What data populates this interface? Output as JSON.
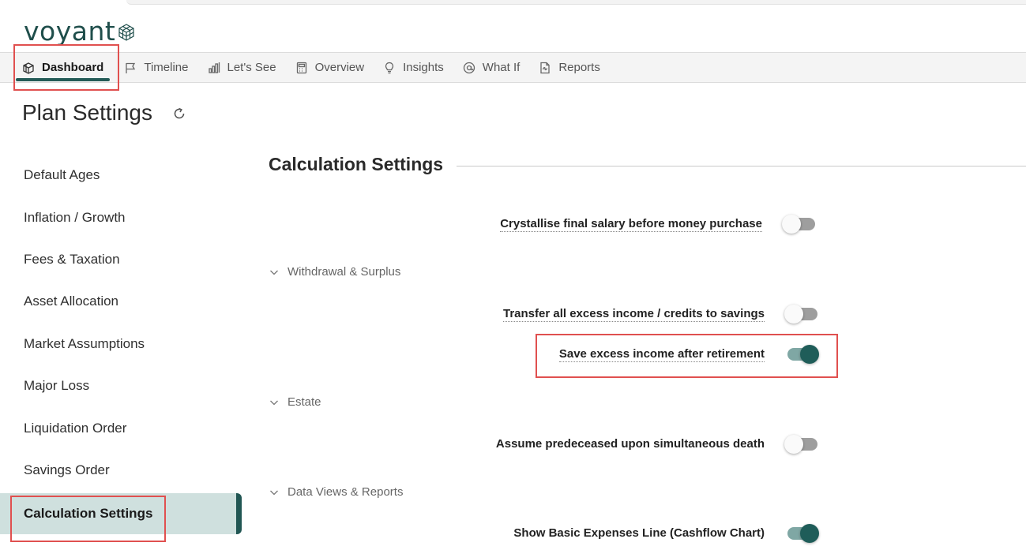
{
  "brand": {
    "name": "voyant",
    "color": "#1f4e4b"
  },
  "nav": {
    "items": [
      {
        "label": "Dashboard",
        "icon": "box-icon",
        "active": true
      },
      {
        "label": "Timeline",
        "icon": "flag-icon"
      },
      {
        "label": "Let's See",
        "icon": "bar-chart-icon"
      },
      {
        "label": "Overview",
        "icon": "calculator-icon"
      },
      {
        "label": "Insights",
        "icon": "lightbulb-icon"
      },
      {
        "label": "What If",
        "icon": "at-sign-icon"
      },
      {
        "label": "Reports",
        "icon": "document-icon"
      }
    ]
  },
  "page": {
    "title": "Plan Settings"
  },
  "sidebar": {
    "items": [
      {
        "label": "Default Ages"
      },
      {
        "label": "Inflation / Growth"
      },
      {
        "label": "Fees & Taxation"
      },
      {
        "label": "Asset Allocation"
      },
      {
        "label": "Market Assumptions"
      },
      {
        "label": "Major Loss"
      },
      {
        "label": "Liquidation Order"
      },
      {
        "label": "Savings Order"
      },
      {
        "label": "Calculation Settings",
        "active": true
      }
    ]
  },
  "main": {
    "section_title": "Calculation Settings",
    "settings": [
      {
        "label": "Crystallise final salary before money purchase",
        "on": false
      },
      {
        "label": "Transfer all excess income / credits to savings",
        "on": false
      },
      {
        "label": "Save excess income after retirement",
        "on": true
      },
      {
        "label": "Assume predeceased upon simultaneous death",
        "on": false
      },
      {
        "label": "Show Basic Expenses Line (Cashflow Chart)",
        "on": true
      }
    ],
    "groups": [
      {
        "label": "Withdrawal & Surplus"
      },
      {
        "label": "Estate"
      },
      {
        "label": "Data Views & Reports"
      }
    ]
  },
  "colors": {
    "accent": "#245b57",
    "toggle_on": "#1f5d59",
    "active_bg": "#cfe0de",
    "highlight": "#e0504f"
  }
}
